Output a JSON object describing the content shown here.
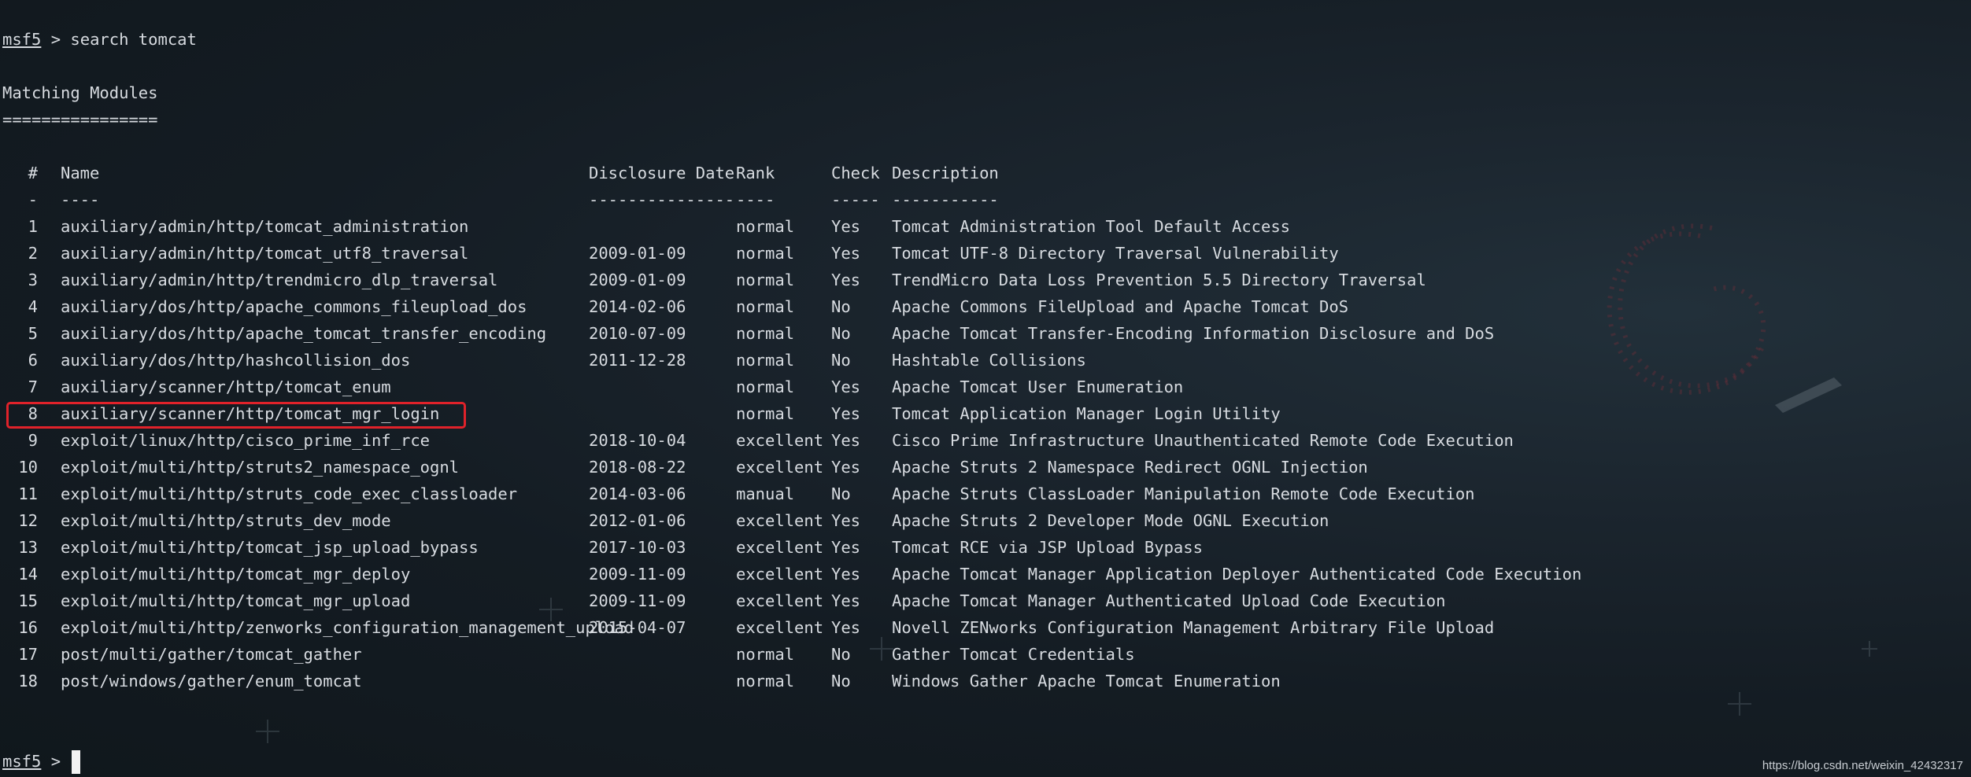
{
  "terminal": {
    "command_line": {
      "prompt": "msf5",
      "separator": " > ",
      "command": "search tomcat"
    },
    "section_title": "Matching Modules",
    "section_underline": "================",
    "table": {
      "headers": {
        "num": "#",
        "name": "Name",
        "date": "Disclosure Date",
        "rank": "Rank",
        "check": "Check",
        "desc": "Description"
      },
      "separators": {
        "num": "-",
        "name": "----",
        "date": "---------------",
        "rank": "----",
        "check": "-----",
        "desc": "-----------"
      },
      "rows": [
        {
          "num": "1",
          "name": "auxiliary/admin/http/tomcat_administration",
          "date": "",
          "rank": "normal",
          "check": "Yes",
          "desc": "Tomcat Administration Tool Default Access"
        },
        {
          "num": "2",
          "name": "auxiliary/admin/http/tomcat_utf8_traversal",
          "date": "2009-01-09",
          "rank": "normal",
          "check": "Yes",
          "desc": "Tomcat UTF-8 Directory Traversal Vulnerability"
        },
        {
          "num": "3",
          "name": "auxiliary/admin/http/trendmicro_dlp_traversal",
          "date": "2009-01-09",
          "rank": "normal",
          "check": "Yes",
          "desc": "TrendMicro Data Loss Prevention 5.5 Directory Traversal"
        },
        {
          "num": "4",
          "name": "auxiliary/dos/http/apache_commons_fileupload_dos",
          "date": "2014-02-06",
          "rank": "normal",
          "check": "No",
          "desc": "Apache Commons FileUpload and Apache Tomcat DoS"
        },
        {
          "num": "5",
          "name": "auxiliary/dos/http/apache_tomcat_transfer_encoding",
          "date": "2010-07-09",
          "rank": "normal",
          "check": "No",
          "desc": "Apache Tomcat Transfer-Encoding Information Disclosure and DoS"
        },
        {
          "num": "6",
          "name": "auxiliary/dos/http/hashcollision_dos",
          "date": "2011-12-28",
          "rank": "normal",
          "check": "No",
          "desc": "Hashtable Collisions"
        },
        {
          "num": "7",
          "name": "auxiliary/scanner/http/tomcat_enum",
          "date": "",
          "rank": "normal",
          "check": "Yes",
          "desc": "Apache Tomcat User Enumeration"
        },
        {
          "num": "8",
          "name": "auxiliary/scanner/http/tomcat_mgr_login",
          "date": "",
          "rank": "normal",
          "check": "Yes",
          "desc": "Tomcat Application Manager Login Utility"
        },
        {
          "num": "9",
          "name": "exploit/linux/http/cisco_prime_inf_rce",
          "date": "2018-10-04",
          "rank": "excellent",
          "check": "Yes",
          "desc": "Cisco Prime Infrastructure Unauthenticated Remote Code Execution"
        },
        {
          "num": "10",
          "name": "exploit/multi/http/struts2_namespace_ognl",
          "date": "2018-08-22",
          "rank": "excellent",
          "check": "Yes",
          "desc": "Apache Struts 2 Namespace Redirect OGNL Injection"
        },
        {
          "num": "11",
          "name": "exploit/multi/http/struts_code_exec_classloader",
          "date": "2014-03-06",
          "rank": "manual",
          "check": "No",
          "desc": "Apache Struts ClassLoader Manipulation Remote Code Execution"
        },
        {
          "num": "12",
          "name": "exploit/multi/http/struts_dev_mode",
          "date": "2012-01-06",
          "rank": "excellent",
          "check": "Yes",
          "desc": "Apache Struts 2 Developer Mode OGNL Execution"
        },
        {
          "num": "13",
          "name": "exploit/multi/http/tomcat_jsp_upload_bypass",
          "date": "2017-10-03",
          "rank": "excellent",
          "check": "Yes",
          "desc": "Tomcat RCE via JSP Upload Bypass"
        },
        {
          "num": "14",
          "name": "exploit/multi/http/tomcat_mgr_deploy",
          "date": "2009-11-09",
          "rank": "excellent",
          "check": "Yes",
          "desc": "Apache Tomcat Manager Application Deployer Authenticated Code Execution"
        },
        {
          "num": "15",
          "name": "exploit/multi/http/tomcat_mgr_upload",
          "date": "2009-11-09",
          "rank": "excellent",
          "check": "Yes",
          "desc": "Apache Tomcat Manager Authenticated Upload Code Execution"
        },
        {
          "num": "16",
          "name": "exploit/multi/http/zenworks_configuration_management_upload",
          "date": "2015-04-07",
          "rank": "excellent",
          "check": "Yes",
          "desc": "Novell ZENworks Configuration Management Arbitrary File Upload"
        },
        {
          "num": "17",
          "name": "post/multi/gather/tomcat_gather",
          "date": "",
          "rank": "normal",
          "check": "No",
          "desc": "Gather Tomcat Credentials"
        },
        {
          "num": "18",
          "name": "post/windows/gather/enum_tomcat",
          "date": "",
          "rank": "normal",
          "check": "No",
          "desc": "Windows Gather Apache Tomcat Enumeration"
        }
      ]
    },
    "final_prompt": {
      "prompt": "msf5",
      "separator": " > "
    }
  },
  "highlight_color": "#e0222a",
  "watermark": "https://blog.csdn.net/weixin_42432317"
}
